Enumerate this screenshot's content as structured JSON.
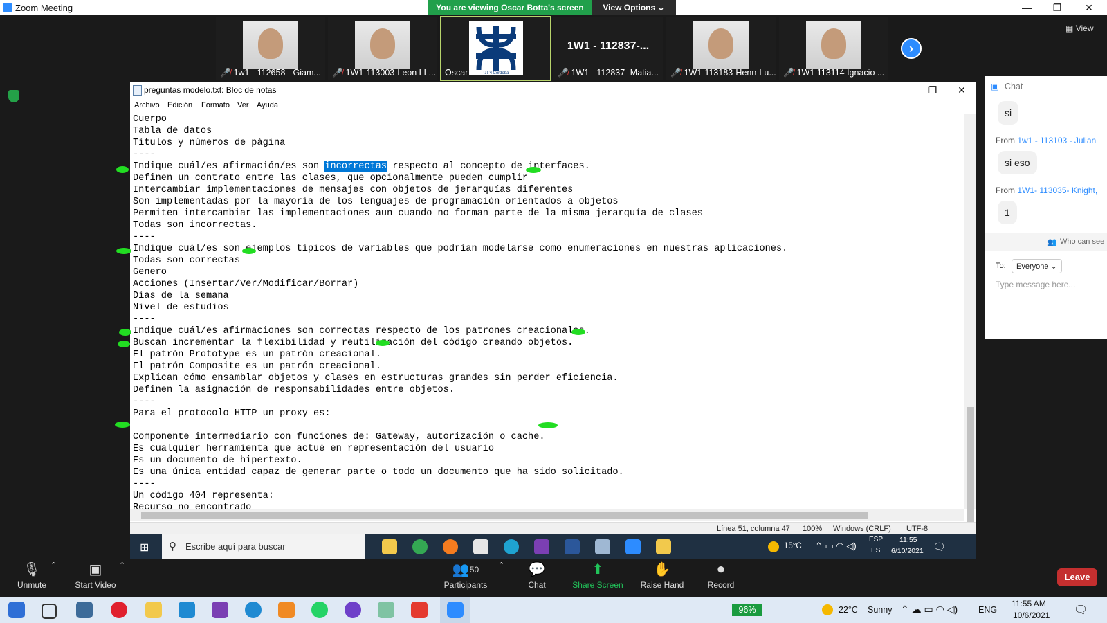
{
  "zoom": {
    "window_title": "Zoom Meeting",
    "viewing_banner": "You are viewing Oscar Botta's screen",
    "view_options": "View Options",
    "view_button": "View",
    "participants": [
      {
        "name": "1w1 - 112658 - Giam..."
      },
      {
        "name": "1W1-113003-Leon LL..."
      },
      {
        "name": "Oscar Botta",
        "active": true,
        "logo_caption": "UTN Córdoba"
      },
      {
        "name": "1W1 - 112837- Matia...",
        "big_label": "1W1 - 112837-..."
      },
      {
        "name": "1W1-113183-Henn-Lu..."
      },
      {
        "name": "1W1 113114 Ignacio ..."
      }
    ],
    "toolbar": {
      "unmute": "Unmute",
      "start_video": "Start Video",
      "participants": "Participants",
      "participants_count": "50",
      "chat": "Chat",
      "share_screen": "Share Screen",
      "raise_hand": "Raise Hand",
      "record": "Record",
      "leave": "Leave"
    }
  },
  "chat": {
    "title": "Chat",
    "messages": [
      {
        "text": "si"
      },
      {
        "from_prefix": "From",
        "from": "1w1 - 113103 - Julian",
        "text": "si eso"
      },
      {
        "from_prefix": "From",
        "from": "1W1- 113035- Knight,",
        "text": "1"
      }
    ],
    "who_can_see": "Who can see",
    "to_label": "To:",
    "to_value": "Everyone",
    "placeholder": "Type message here..."
  },
  "notepad": {
    "title": "preguntas modelo.txt: Bloc de notas",
    "menu": [
      "Archivo",
      "Edición",
      "Formato",
      "Ver",
      "Ayuda"
    ],
    "lines": [
      "Cuerpo",
      "Tabla de datos",
      "Títulos y números de página",
      "----",
      "Indique cuál/es afirmación/es son incorrectas respecto al concepto de interfaces.",
      "Definen un contrato entre las clases, que opcionalmente pueden cumplir",
      "Intercambiar implementaciones de mensajes con objetos de jerarquías diferentes",
      "Son implementadas por la mayoría de los lenguajes de programación orientados a objetos",
      "Permiten intercambiar las implementaciones aun cuando no forman parte de la misma jerarquía de clases",
      "Todas son incorrectas.",
      "----",
      "Indique cuál/es son ejemplos típicos de variables que podrían modelarse como enumeraciones en nuestras aplicaciones.",
      "Todas son correctas",
      "Genero",
      "Acciones (Insertar/Ver/Modificar/Borrar)",
      "Días de la semana",
      "Nivel de estudios",
      "----",
      "Indique cuál/es afirmaciones son correctas respecto de los patrones creacionales.",
      "Buscan incrementar la flexibilidad y reutilización del código creando objetos.",
      "El patrón Prototype es un patrón creacional.",
      "El patrón Composite es un patrón creacional.",
      "Explican cómo ensamblar objetos y clases en estructuras grandes sin perder eficiencia.",
      "Definen la asignación de responsabilidades entre objetos.",
      "----",
      "Para el protocolo HTTP un proxy es:",
      "",
      "Componente intermediario con funciones de: Gateway, autorización o cache.",
      "Es cualquier herramienta que actué en representación del usuario",
      "Es un documento de hipertexto.",
      "Es una única entidad capaz de generar parte o todo un documento que ha sido solicitado.",
      "----",
      "Un código 404 representa:",
      "Recurso no encontrado"
    ],
    "selected_word": "incorrectas",
    "status": {
      "position": "Línea 51, columna 47",
      "zoom": "100%",
      "line_ending": "Windows (CRLF)",
      "encoding": "UTF-8"
    }
  },
  "shared_taskbar": {
    "search_placeholder": "Escribe aquí para buscar",
    "weather": "15°C",
    "lang_top": "ESP",
    "lang_bottom": "ES",
    "time": "11:55",
    "date": "6/10/2021"
  },
  "local_taskbar": {
    "battery": "96%",
    "weather": "22°C",
    "weather_desc": "Sunny",
    "lang": "ENG",
    "time": "11:55 AM",
    "date": "10/6/2021"
  },
  "colors": {
    "zoom_blue": "#2d8cff",
    "banner_green": "#21a04b",
    "leave_red": "#c42f2f",
    "highlight_green": "#22dd22",
    "selection_blue": "#0078d7"
  }
}
